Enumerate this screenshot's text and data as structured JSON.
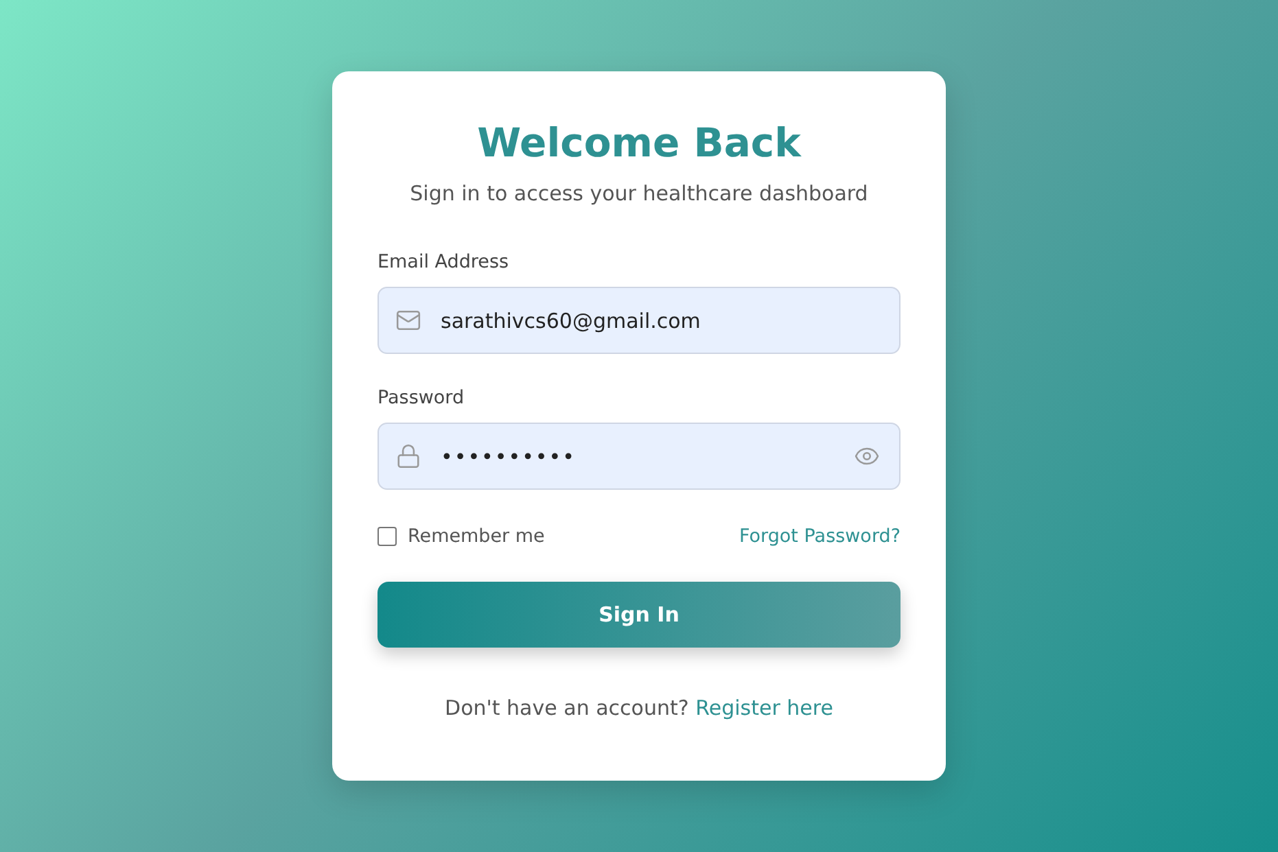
{
  "card": {
    "title": "Welcome Back",
    "subtitle": "Sign in to access your healthcare dashboard"
  },
  "fields": [
    {
      "kind": "email",
      "label": "Email Address",
      "value": "sarathivcs60@gmail.com"
    },
    {
      "kind": "password",
      "label": "Password",
      "value": "••••••••••"
    }
  ],
  "remember": {
    "label": "Remember me",
    "checked": false
  },
  "forgot_link": "Forgot Password?",
  "submit": "Sign In",
  "footer": {
    "prompt": "Don't have an account?",
    "link": "Register here"
  }
}
